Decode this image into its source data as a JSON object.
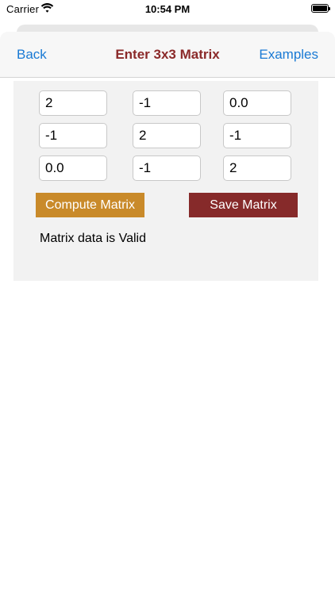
{
  "status_bar": {
    "carrier": "Carrier",
    "time": "10:54 PM",
    "battery_level": 1.0
  },
  "nav": {
    "back_label": "Back",
    "title": "Enter 3x3 Matrix",
    "examples_label": "Examples"
  },
  "matrix": {
    "r0": [
      "2",
      "-1",
      "0.0"
    ],
    "r1": [
      "-1",
      "2",
      "-1"
    ],
    "r2": [
      "0.0",
      "-1",
      "2"
    ]
  },
  "actions": {
    "compute_label": "Compute Matrix",
    "save_label": "Save Matrix"
  },
  "validation": {
    "message": "Matrix data is Valid"
  },
  "colors": {
    "link": "#1a7ad4",
    "title": "#8b2a2a",
    "compute_button": "#c98a2a",
    "save_button": "#862a2a"
  }
}
